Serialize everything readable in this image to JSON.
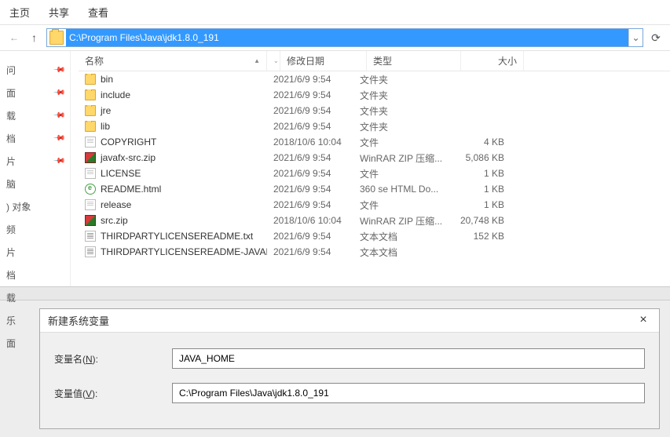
{
  "tabs": {
    "home": "主页",
    "share": "共享",
    "view": "查看"
  },
  "nav": {
    "back": "←",
    "up": "↑",
    "path": "C:\\Program Files\\Java\\jdk1.8.0_191",
    "refresh": "⟳"
  },
  "sidebar": {
    "items": [
      {
        "label": "问"
      },
      {
        "label": "面"
      },
      {
        "label": "载"
      },
      {
        "label": "档"
      },
      {
        "label": "片"
      },
      {
        "label": "脑"
      },
      {
        "label": ") 对象"
      },
      {
        "label": "频"
      },
      {
        "label": "片"
      },
      {
        "label": "档"
      },
      {
        "label": "载"
      },
      {
        "label": "乐"
      },
      {
        "label": "面"
      }
    ]
  },
  "columns": {
    "name": "名称",
    "date": "修改日期",
    "type": "类型",
    "size": "大小"
  },
  "rows": [
    {
      "icon": "folder",
      "name": "bin",
      "date": "2021/6/9 9:54",
      "type": "文件夹",
      "size": ""
    },
    {
      "icon": "folder",
      "name": "include",
      "date": "2021/6/9 9:54",
      "type": "文件夹",
      "size": ""
    },
    {
      "icon": "folder",
      "name": "jre",
      "date": "2021/6/9 9:54",
      "type": "文件夹",
      "size": ""
    },
    {
      "icon": "folder",
      "name": "lib",
      "date": "2021/6/9 9:54",
      "type": "文件夹",
      "size": ""
    },
    {
      "icon": "file",
      "name": "COPYRIGHT",
      "date": "2018/10/6 10:04",
      "type": "文件",
      "size": "4 KB"
    },
    {
      "icon": "zip",
      "name": "javafx-src.zip",
      "date": "2021/6/9 9:54",
      "type": "WinRAR ZIP 压缩...",
      "size": "5,086 KB"
    },
    {
      "icon": "file",
      "name": "LICENSE",
      "date": "2021/6/9 9:54",
      "type": "文件",
      "size": "1 KB"
    },
    {
      "icon": "html",
      "name": "README.html",
      "date": "2021/6/9 9:54",
      "type": "360 se HTML Do...",
      "size": "1 KB"
    },
    {
      "icon": "file",
      "name": "release",
      "date": "2021/6/9 9:54",
      "type": "文件",
      "size": "1 KB"
    },
    {
      "icon": "zip",
      "name": "src.zip",
      "date": "2018/10/6 10:04",
      "type": "WinRAR ZIP 压缩...",
      "size": "20,748 KB"
    },
    {
      "icon": "txt",
      "name": "THIRDPARTYLICENSEREADME.txt",
      "date": "2021/6/9 9:54",
      "type": "文本文档",
      "size": "152 KB"
    },
    {
      "icon": "txt",
      "name": "THIRDPARTYLICENSEREADME-JAVAF...",
      "date": "2021/6/9 9:54",
      "type": "文本文档",
      "size": ""
    }
  ],
  "dialog": {
    "title": "新建系统变量",
    "name_label": "变量名(",
    "name_key": "N",
    "name_suffix": "):",
    "name_value": "JAVA_HOME",
    "value_label": "变量值(",
    "value_key": "V",
    "value_suffix": "):",
    "value_value": "C:\\Program Files\\Java\\jdk1.8.0_191"
  }
}
